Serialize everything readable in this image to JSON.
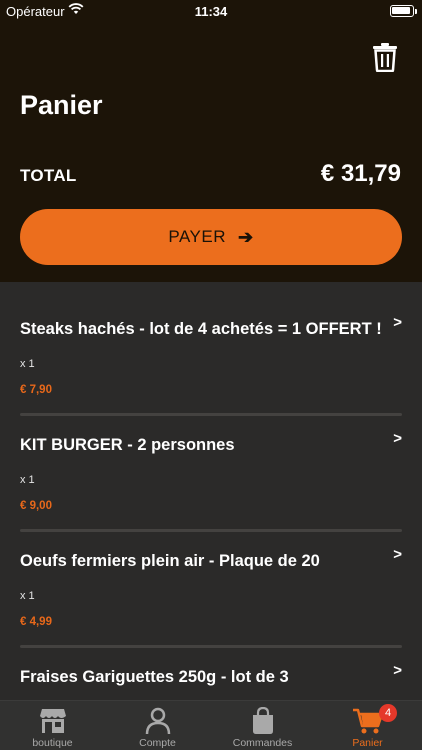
{
  "status": {
    "carrier": "Opérateur",
    "time": "11:34"
  },
  "header": {
    "title": "Panier",
    "total_label": "TOTAL",
    "total_value": "€ 31,79",
    "pay_label": "PAYER"
  },
  "items": [
    {
      "name": "Steaks hachés - lot de 4 achetés = 1 OFFERT !",
      "qty": "x 1",
      "price": "€ 7,90"
    },
    {
      "name": "KIT BURGER - 2 personnes",
      "qty": "x 1",
      "price": "€ 9,00"
    },
    {
      "name": "Oeufs fermiers plein air - Plaque de 20",
      "qty": "x 1",
      "price": "€ 4,99"
    },
    {
      "name": "Fraises Gariguettes 250g - lot de 3",
      "qty": "",
      "price": ""
    }
  ],
  "tabs": [
    {
      "label": "boutique",
      "icon": "shop-icon"
    },
    {
      "label": "Compte",
      "icon": "user-icon"
    },
    {
      "label": "Commandes",
      "icon": "bag-icon"
    },
    {
      "label": "Panier",
      "icon": "cart-icon",
      "badge": "4",
      "active": true
    }
  ],
  "colors": {
    "accent": "#ec6e1d",
    "header_bg": "#1c1408",
    "list_bg": "#2b2a29",
    "badge": "#e5382a"
  }
}
